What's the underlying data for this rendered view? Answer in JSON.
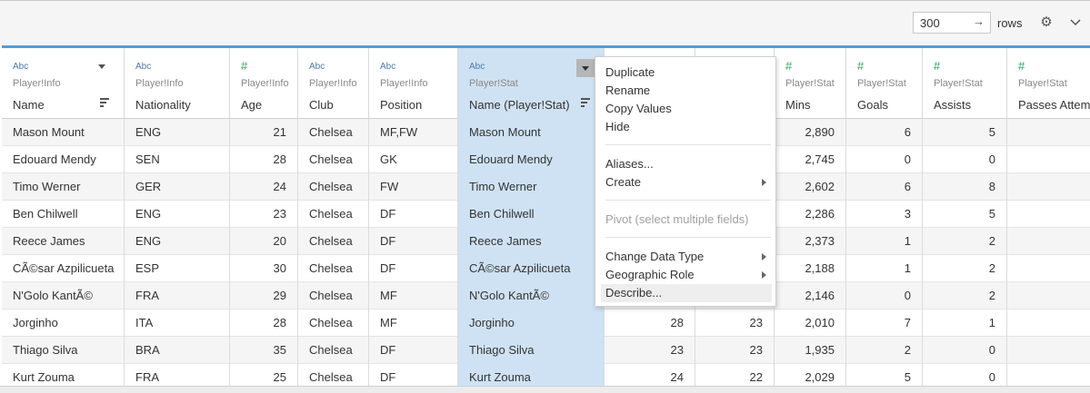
{
  "toolbar": {
    "rows_value": "300",
    "rows_label": "rows",
    "rows_arrow_icon": "arrow-right-icon",
    "settings_icon": "gear-icon",
    "menu_icon": "chevron-down-icon"
  },
  "columns": [
    {
      "type_label": "Abc",
      "source": "Player!Info",
      "name": "Name"
    },
    {
      "type_label": "Abc",
      "source": "Player!Info",
      "name": "Nationality"
    },
    {
      "type_label": "#",
      "source": "Player!Info",
      "name": "Age"
    },
    {
      "type_label": "Abc",
      "source": "Player!Info",
      "name": "Club"
    },
    {
      "type_label": "Abc",
      "source": "Player!Info",
      "name": "Position"
    },
    {
      "type_label": "Abc",
      "source": "Player!Stat",
      "name": "Name (Player!Stat)"
    },
    {
      "type_label": "",
      "source": "",
      "name": ""
    },
    {
      "type_label": "",
      "source": "",
      "name": ""
    },
    {
      "type_label": "#",
      "source": "Player!Stat",
      "name": "Mins"
    },
    {
      "type_label": "#",
      "source": "Player!Stat",
      "name": "Goals"
    },
    {
      "type_label": "#",
      "source": "Player!Stat",
      "name": "Assists"
    },
    {
      "type_label": "#",
      "source": "Player!Stat",
      "name": "Passes Attem"
    }
  ],
  "rows": [
    [
      "Mason Mount",
      "ENG",
      "21",
      "Chelsea",
      "MF,FW",
      "Mason Mount",
      "",
      "",
      "2,890",
      "6",
      "5",
      ""
    ],
    [
      "Edouard Mendy",
      "SEN",
      "28",
      "Chelsea",
      "GK",
      "Edouard Mendy",
      "",
      "",
      "2,745",
      "0",
      "0",
      ""
    ],
    [
      "Timo Werner",
      "GER",
      "24",
      "Chelsea",
      "FW",
      "Timo Werner",
      "",
      "",
      "2,602",
      "6",
      "8",
      ""
    ],
    [
      "Ben Chilwell",
      "ENG",
      "23",
      "Chelsea",
      "DF",
      "Ben Chilwell",
      "",
      "",
      "2,286",
      "3",
      "5",
      ""
    ],
    [
      "Reece James",
      "ENG",
      "20",
      "Chelsea",
      "DF",
      "Reece James",
      "",
      "",
      "2,373",
      "1",
      "2",
      ""
    ],
    [
      "CÃ©sar Azpilicueta",
      "ESP",
      "30",
      "Chelsea",
      "DF",
      "CÃ©sar Azpilicueta",
      "",
      "",
      "2,188",
      "1",
      "2",
      ""
    ],
    [
      "N'Golo KantÃ©",
      "FRA",
      "29",
      "Chelsea",
      "MF",
      "N'Golo KantÃ©",
      "",
      "",
      "2,146",
      "0",
      "2",
      ""
    ],
    [
      "Jorginho",
      "ITA",
      "28",
      "Chelsea",
      "MF",
      "Jorginho",
      "28",
      "23",
      "2,010",
      "7",
      "1",
      ""
    ],
    [
      "Thiago Silva",
      "BRA",
      "35",
      "Chelsea",
      "DF",
      "Thiago Silva",
      "23",
      "23",
      "1,935",
      "2",
      "0",
      ""
    ],
    [
      "Kurt Zouma",
      "FRA",
      "25",
      "Chelsea",
      "DF",
      "Kurt Zouma",
      "24",
      "22",
      "2,029",
      "5",
      "0",
      ""
    ]
  ],
  "context_menu": {
    "items": [
      {
        "label": "Duplicate"
      },
      {
        "label": "Rename"
      },
      {
        "label": "Copy Values"
      },
      {
        "label": "Hide"
      },
      {
        "label": "Aliases..."
      },
      {
        "label": "Create"
      },
      {
        "label": "Pivot (select multiple fields)"
      },
      {
        "label": "Change Data Type"
      },
      {
        "label": "Geographic Role"
      },
      {
        "label": "Describe..."
      }
    ]
  },
  "colors": {
    "selected_column": "#cfe2f3",
    "header_accent": "#5b9bd5",
    "string_type": "#4e79a7",
    "number_type": "#2ca25f"
  }
}
